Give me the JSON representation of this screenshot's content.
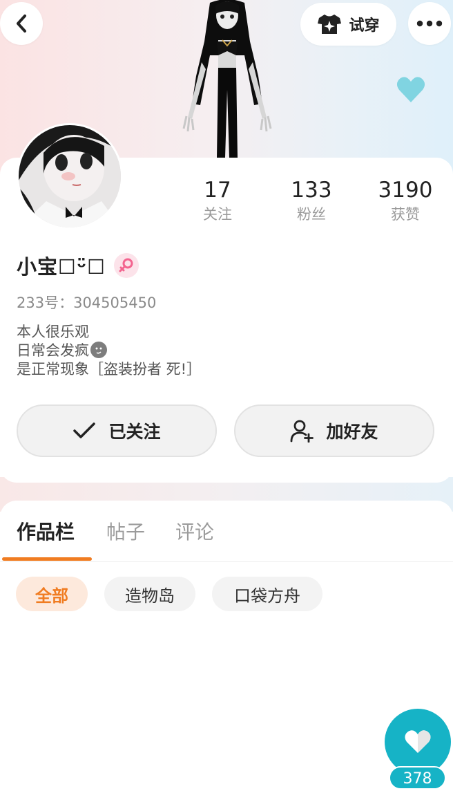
{
  "header": {
    "back_icon": "chevron-left-icon",
    "tryon_label": "试穿",
    "tryon_icon": "tshirt-sparkle-icon",
    "more_icon": "more-dots-icon",
    "like_icon": "heart-icon",
    "like_color": "#7fd3e0"
  },
  "stats": [
    {
      "value": "17",
      "label": "关注"
    },
    {
      "value": "133",
      "label": "粉丝"
    },
    {
      "value": "3190",
      "label": "获赞"
    }
  ],
  "profile": {
    "name": "小宝☐ᵕ̈☐",
    "gender_icon": "female-icon",
    "gender_color": "#f3648f",
    "uid_text": "233号：304505450",
    "bio_lines": [
      "本人很乐观",
      "日常会发疯",
      "是正常现象［盗装扮者 死!］"
    ]
  },
  "actions": {
    "follow_label": "已关注",
    "follow_icon": "check-icon",
    "add_friend_label": "加好友",
    "add_friend_icon": "add-user-icon"
  },
  "tabs": [
    {
      "label": "作品栏",
      "active": true
    },
    {
      "label": "帖子",
      "active": false
    },
    {
      "label": "评论",
      "active": false
    }
  ],
  "filters": [
    {
      "label": "全部",
      "active": true
    },
    {
      "label": "造物岛",
      "active": false
    },
    {
      "label": "口袋方舟",
      "active": false
    }
  ],
  "floating_like": {
    "count": "378",
    "icon": "heart-icon",
    "color": "#16b3c6"
  },
  "colors": {
    "accent": "#f07c21",
    "teal": "#16b3c6"
  }
}
